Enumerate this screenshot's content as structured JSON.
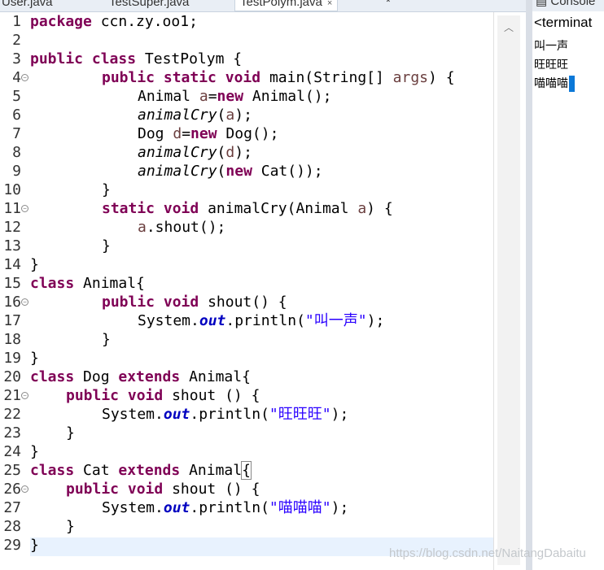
{
  "tabs": [
    {
      "label": "User.java",
      "active": false
    },
    {
      "label": "TestSuper.java",
      "active": false
    },
    {
      "label": "TestPolym.java",
      "active": true,
      "close": "×"
    },
    {
      "label": "*",
      "active": false
    }
  ],
  "editor": {
    "lines": [
      {
        "n": "1"
      },
      {
        "n": "2"
      },
      {
        "n": "3"
      },
      {
        "n": "4"
      },
      {
        "n": "5"
      },
      {
        "n": "6"
      },
      {
        "n": "7"
      },
      {
        "n": "8"
      },
      {
        "n": "9"
      },
      {
        "n": "10"
      },
      {
        "n": "11"
      },
      {
        "n": "12"
      },
      {
        "n": "13"
      },
      {
        "n": "14"
      },
      {
        "n": "15"
      },
      {
        "n": "16"
      },
      {
        "n": "17"
      },
      {
        "n": "18"
      },
      {
        "n": "19"
      },
      {
        "n": "20"
      },
      {
        "n": "21"
      },
      {
        "n": "22"
      },
      {
        "n": "23"
      },
      {
        "n": "24"
      },
      {
        "n": "25"
      },
      {
        "n": "26"
      },
      {
        "n": "27"
      },
      {
        "n": "28"
      },
      {
        "n": "29"
      }
    ],
    "code": {
      "l1_kw": "package",
      "l1_rest": " ccn.zy.oo1;",
      "l3_kw1": "public",
      "l3_kw2": "class",
      "l3_rest": " TestPolym {",
      "l4_kw1": "public",
      "l4_kw2": "static",
      "l4_kw3": "void",
      "l4_rest1": " main(String[] ",
      "l4_var": "args",
      "l4_rest2": ") {",
      "l5_a": "Animal ",
      "l5_var": "a",
      "l5_b": "=",
      "l5_kw": "new",
      "l5_c": " Animal();",
      "l6_m": "animalCry",
      "l6_a": "(",
      "l6_var": "a",
      "l6_b": ");",
      "l7_a": "Dog ",
      "l7_var": "d",
      "l7_b": "=",
      "l7_kw": "new",
      "l7_c": " Dog();",
      "l8_m": "animalCry",
      "l8_a": "(",
      "l8_var": "d",
      "l8_b": ");",
      "l9_m": "animalCry",
      "l9_a": "(",
      "l9_kw": "new",
      "l9_b": " Cat());",
      "l10": "}",
      "l11_kw1": "static",
      "l11_kw2": "void",
      "l11_rest1": " animalCry(Animal ",
      "l11_var": "a",
      "l11_rest2": ") {",
      "l12_var": "a",
      "l12_rest": ".shout();",
      "l13": "}",
      "l14": "}",
      "l15_kw": "class",
      "l15_rest": " Animal{",
      "l16_kw1": "public",
      "l16_kw2": "void",
      "l16_rest": " shout() {",
      "l17_a": "System.",
      "l17_fld": "out",
      "l17_b": ".println(",
      "l17_str": "\"叫一声\"",
      "l17_c": ");",
      "l18": "}",
      "l19": "}",
      "l20_kw1": "class",
      "l20_a": " Dog ",
      "l20_kw2": "extends",
      "l20_b": " Animal{",
      "l21_kw1": "public",
      "l21_kw2": "void",
      "l21_rest": " shout () {",
      "l22_a": "System.",
      "l22_fld": "out",
      "l22_b": ".println(",
      "l22_str": "\"旺旺旺\"",
      "l22_c": ");",
      "l23": "}",
      "l24": "}",
      "l25_kw1": "class",
      "l25_a": " Cat ",
      "l25_kw2": "extends",
      "l25_b": " Animal",
      "l25_br": "{",
      "l26_kw1": "public",
      "l26_kw2": "void",
      "l26_rest": " shout () {",
      "l27_a": "System.",
      "l27_fld": "out",
      "l27_b": ".println(",
      "l27_str": "\"喵喵喵\"",
      "l27_c": ");",
      "l28": "}",
      "l29": "}"
    }
  },
  "console": {
    "title": "Console",
    "terminated": "<terminat",
    "output": [
      "叫一声",
      "旺旺旺",
      "喵喵喵"
    ]
  },
  "watermark": "https://blog.csdn.net/NaitangDabaitu",
  "colors": {
    "keyword": "#7f0055",
    "string": "#2a00ff",
    "variable": "#6a3e3e",
    "field": "#0000c0",
    "current_line": "#e8f2fe",
    "cursor": "#0b78d8"
  },
  "icons": [
    "console-icon",
    "fold-marker-icon",
    "scroll-up-icon"
  ]
}
